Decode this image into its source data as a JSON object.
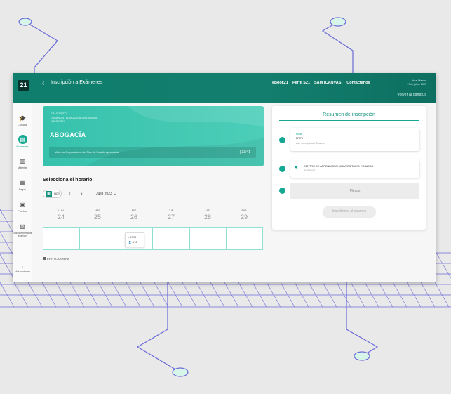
{
  "app": {
    "logo_text": "21",
    "back_glyph": "‹",
    "title": "Inscripción a Exámenes",
    "accent": "#14a892",
    "header_color": "#0f7e6c"
  },
  "nav": {
    "links": [
      "eBook21",
      "Perfil S21",
      "SAM (CANVAS)",
      "Contactanos"
    ],
    "user_greeting": "Hola, Marcos",
    "user_date": "17 de julio - 2023",
    "back_to_campus": "Volver al campus"
  },
  "sidebar": {
    "items": [
      {
        "label": "Cursada",
        "icon": "graduation-cap-icon",
        "glyph": "🎓",
        "active": false
      },
      {
        "label": "Exámenes",
        "icon": "document-icon",
        "glyph": "▤",
        "active": true
      },
      {
        "label": "Materias",
        "icon": "book-icon",
        "glyph": "▥",
        "active": false
      },
      {
        "label": "Pagos",
        "icon": "receipt-icon",
        "glyph": "▦",
        "active": false
      },
      {
        "label": "Pruebas",
        "icon": "printer-icon",
        "glyph": "▣",
        "active": false
      },
      {
        "label": "Solicitar mesa de examen",
        "icon": "book-open-icon",
        "glyph": "▧",
        "active": false
      },
      {
        "label": "Más opciones",
        "icon": "more-vertical-icon",
        "glyph": "⋮",
        "active": false
      }
    ]
  },
  "hero": {
    "meta": [
      "GRADO INTO",
      "DISTANCIA - EDUCACIÓN DISTRIBUIDA",
      "VHGS23931"
    ],
    "career": "ABOGACÍA",
    "subjects_label": "Materias Preparatorias del Plan de Estudio Aprobadas",
    "subjects_count": "| 33/41"
  },
  "schedule": {
    "title": "Selecciona el horario:",
    "today_label": "HOY",
    "calendar_glyph": "▦",
    "prev_glyph": "‹",
    "next_glyph": "›",
    "month": "Julio 2023",
    "month_chevron": "⌄",
    "days": [
      {
        "name": "LUN",
        "num": "24"
      },
      {
        "name": "MAR",
        "num": "25"
      },
      {
        "name": "MIÉ",
        "num": "26"
      },
      {
        "name": "JUE",
        "num": "27"
      },
      {
        "name": "VIE",
        "num": "28"
      },
      {
        "name": "SÁB",
        "num": "29"
      }
    ],
    "slot": {
      "time": "17:00",
      "seats": "0/12"
    },
    "legend": "EFIP I CARRERA"
  },
  "summary": {
    "title": "Resumen de inscripción",
    "step1": {
      "label": "Final",
      "subject": "EFIP I",
      "detail": "Aún no registrada. Examen"
    },
    "step2": {
      "location": "CENTRO DE APRENDIZAJE UNIVERSITARIO POSADAS",
      "city": "POSADAS"
    },
    "step3": {
      "mesas": "Mesas"
    },
    "submit_label": "Inscribirme al examen"
  }
}
